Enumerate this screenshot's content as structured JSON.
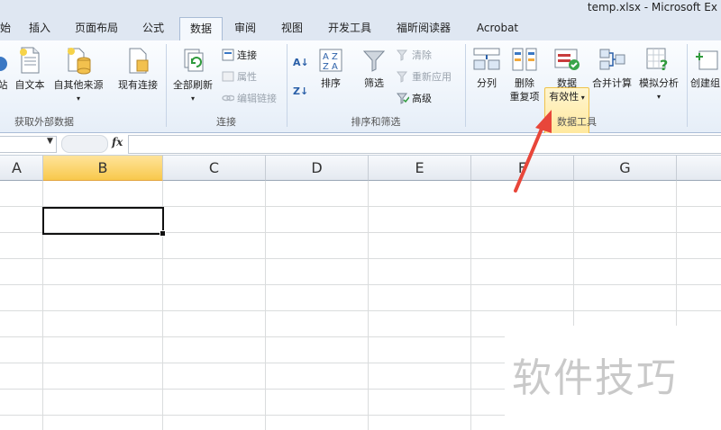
{
  "window": {
    "title": "temp.xlsx - Microsoft Ex"
  },
  "tabs": [
    {
      "label": "始",
      "active": false
    },
    {
      "label": "插入",
      "active": false
    },
    {
      "label": "页面布局",
      "active": false
    },
    {
      "label": "公式",
      "active": false
    },
    {
      "label": "数据",
      "active": true
    },
    {
      "label": "审阅",
      "active": false
    },
    {
      "label": "视图",
      "active": false
    },
    {
      "label": "开发工具",
      "active": false
    },
    {
      "label": "福昕阅读器",
      "active": false
    },
    {
      "label": "Acrobat",
      "active": false
    }
  ],
  "ribbon": {
    "external_data": {
      "group_label": "获取外部数据",
      "web": "站",
      "from_text": "自文本",
      "from_other": "自其他来源",
      "existing": "现有连接"
    },
    "connections": {
      "group_label": "连接",
      "refresh_all": "全部刷新",
      "connections": "连接",
      "properties": "属性",
      "edit_links": "编辑链接"
    },
    "sort_filter": {
      "group_label": "排序和筛选",
      "sort": "排序",
      "filter": "筛选",
      "clear": "清除",
      "reapply": "重新应用",
      "advanced": "高级"
    },
    "data_tools": {
      "group_label": "数据工具",
      "text_to_columns": "分列",
      "remove_dup_line1": "删除",
      "remove_dup_line2": "重复项",
      "validation_line1": "数据",
      "validation_line2": "有效性",
      "consolidate": "合并计算",
      "what_if": "模拟分析",
      "group": "创建组"
    }
  },
  "formula_bar": {
    "name_box": "",
    "fx": "fx",
    "value": ""
  },
  "columns": [
    "A",
    "B",
    "C",
    "D",
    "E",
    "F",
    "G"
  ],
  "selected_column": "B",
  "watermark": "软件技巧",
  "colors": {
    "arrow": "#e8463a",
    "highlight": "#ffe38a",
    "selected_header": "#f8c94c"
  }
}
